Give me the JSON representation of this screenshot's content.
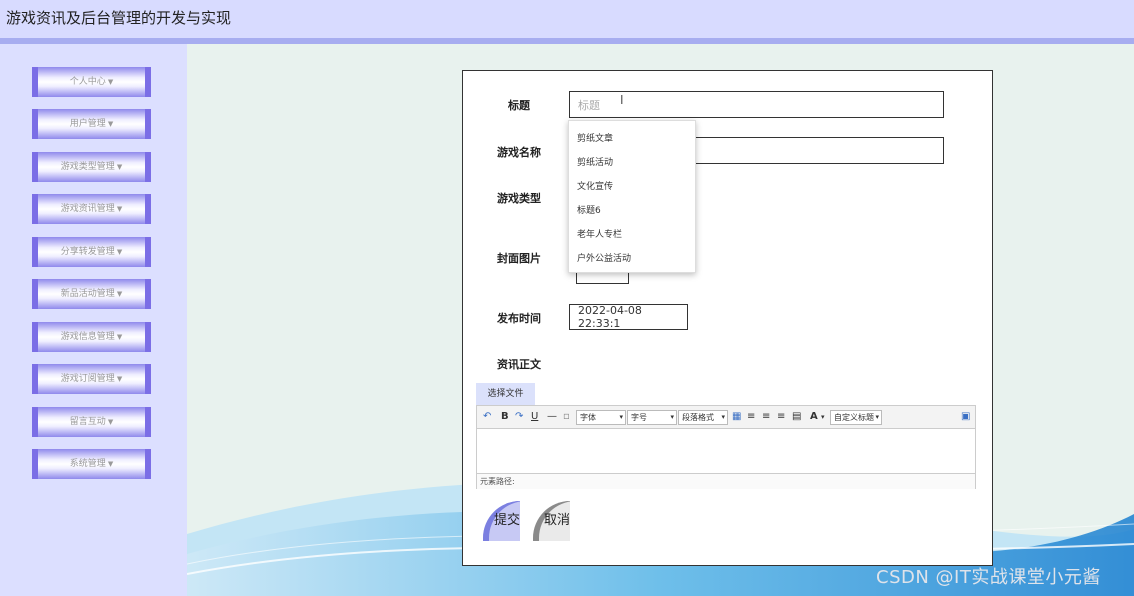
{
  "app": {
    "title": "游戏资讯及后台管理的开发与实现"
  },
  "sidebar": {
    "items": [
      {
        "label": "个人中心"
      },
      {
        "label": "用户管理"
      },
      {
        "label": "游戏类型管理"
      },
      {
        "label": "游戏资讯管理"
      },
      {
        "label": "分享转发管理"
      },
      {
        "label": "新品活动管理"
      },
      {
        "label": "游戏信息管理"
      },
      {
        "label": "游戏订阅管理"
      },
      {
        "label": "留言互动"
      },
      {
        "label": "系统管理"
      }
    ]
  },
  "form": {
    "title_label": "标题",
    "title_placeholder": "标题",
    "game_name_label": "游戏名称",
    "game_type_label": "游戏类型",
    "cover_label": "封面图片",
    "publish_time_label": "发布时间",
    "publish_time_value": "2022-04-08 22:33:1",
    "body_label": "资讯正文",
    "file_button": "选择文件",
    "submit": "提交",
    "cancel": "取消"
  },
  "autocomplete": {
    "items": [
      "剪纸文章",
      "剪纸活动",
      "文化宣传",
      "标题6",
      "老年人专栏",
      "户外公益活动"
    ]
  },
  "editor": {
    "font_select": "字体",
    "size_select": "字号",
    "paragraph_select": "段落格式",
    "custom_title_select": "自定义标题",
    "element_path": "元素路径:"
  },
  "watermark": "CSDN @IT实战课堂小元酱"
}
